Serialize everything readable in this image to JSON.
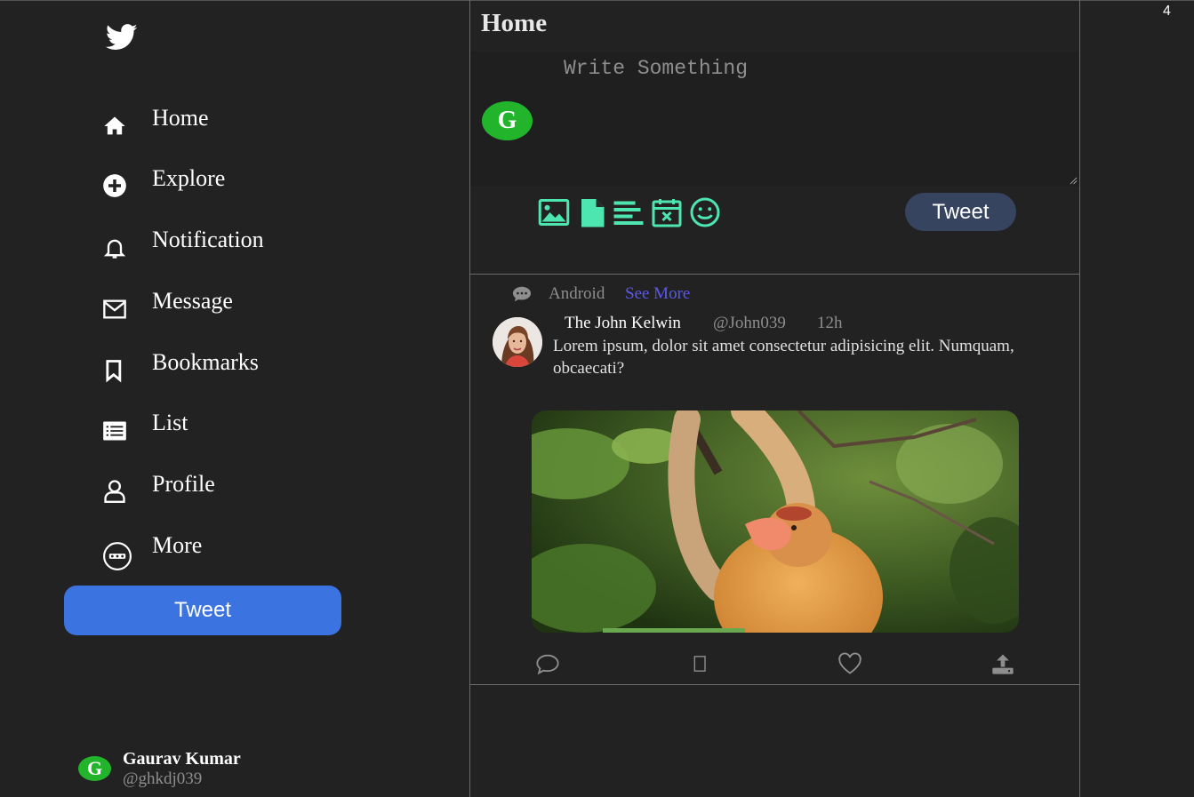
{
  "overlay": {
    "number": "4"
  },
  "sidebar": {
    "logo_icon": "twitter-bird-icon",
    "items": [
      {
        "label": "Home",
        "icon": "home-icon"
      },
      {
        "label": "Explore",
        "icon": "plus-circle-icon"
      },
      {
        "label": "Notification",
        "icon": "bell-icon"
      },
      {
        "label": "Message",
        "icon": "envelope-icon"
      },
      {
        "label": "Bookmarks",
        "icon": "bookmark-icon"
      },
      {
        "label": "List",
        "icon": "list-icon"
      },
      {
        "label": "Profile",
        "icon": "user-icon"
      },
      {
        "label": "More",
        "icon": "more-circle-icon"
      }
    ],
    "tweet_button": "Tweet",
    "user": {
      "avatar_letter": "G",
      "name": "Gaurav Kumar",
      "handle": "@ghkdj039"
    }
  },
  "main": {
    "title": "Home",
    "compose": {
      "placeholder": "Write Something",
      "avatar_letter": "G",
      "tools": [
        "image-icon",
        "file-icon",
        "align-left-icon",
        "calendar-x-icon",
        "smiley-icon"
      ],
      "tweet_button": "Tweet"
    },
    "post": {
      "tag": "Android",
      "see_more": "See More",
      "author": "The John Kelwin",
      "handle": "@John039",
      "time": "12h",
      "text": "Lorem ipsum, dolor sit amet consectetur adipisicing elit. Numquam, obcaecati?",
      "actions": [
        "comment-icon",
        "retweet-icon",
        "heart-icon",
        "share-icon"
      ]
    }
  },
  "colors": {
    "background": "#222222",
    "accent_blue": "#3b73e1",
    "avatar_green": "#22b52c",
    "tool_green": "#4ee6b0",
    "link_purple": "#5b57f0",
    "compose_button": "#36445f"
  }
}
